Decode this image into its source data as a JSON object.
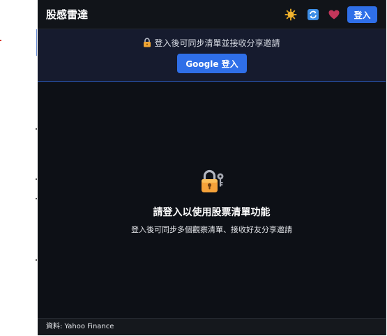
{
  "app": {
    "title": "股感雷達"
  },
  "header": {
    "icons": [
      "sun-icon",
      "refresh-icon",
      "heart-icon"
    ],
    "login_label": "登入"
  },
  "banner": {
    "message": "登入後可同步清單並接收分享邀請",
    "google_button_label": "Google 登入"
  },
  "empty_state": {
    "icon": "lock-key-icon",
    "title": "請登入以使用股票清單功能",
    "subtitle": "登入後可同步多個觀察清單、接收好友分享邀請"
  },
  "footer": {
    "source": "資料: Yahoo Finance"
  },
  "colors": {
    "background": "#0d1016",
    "header_bg": "#111419",
    "banner_bg": "#161b2e",
    "accent": "#2f6fe8"
  }
}
